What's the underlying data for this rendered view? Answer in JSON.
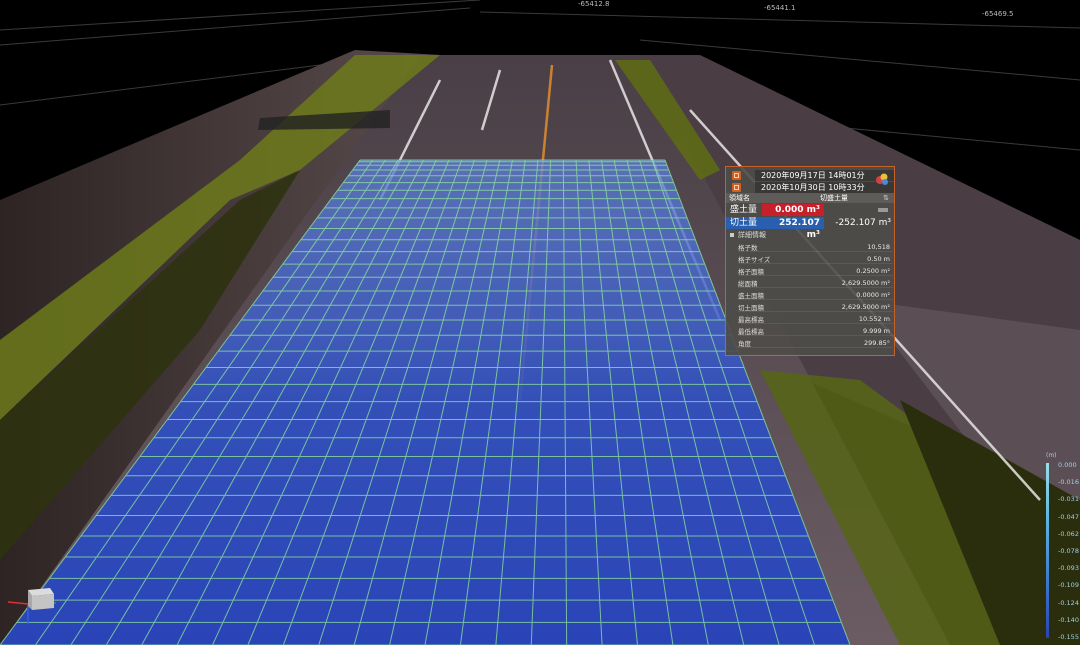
{
  "top_coords": [
    "-65412.8",
    "-65441.1",
    "-65469.5"
  ],
  "panel": {
    "date_before": "2020年09月17日 14時01分",
    "date_after": "2020年10月30日 10時33分",
    "header_name": "領域名",
    "header_cutfill": "切盛土量",
    "fill_label": "盛土量",
    "fill_value": "0.000 m³",
    "cut_label": "切土量",
    "cut_value": "252.107 m³",
    "net_value": "-252.107 m³",
    "detail_title": "詳細情報",
    "details": [
      {
        "label": "格子数",
        "value": "10,518"
      },
      {
        "label": "格子サイズ",
        "value": "0.50 m"
      },
      {
        "label": "格子面積",
        "value": "0.2500 m²"
      },
      {
        "label": "総面積",
        "value": "2,629.5000 m²"
      },
      {
        "label": "盛土面積",
        "value": "0.0000 m²"
      },
      {
        "label": "切土面積",
        "value": "2,629.5000 m²"
      },
      {
        "label": "最高標高",
        "value": "10.552 m"
      },
      {
        "label": "最低標高",
        "value": "9.999 m"
      },
      {
        "label": "角度",
        "value": "299.85°"
      }
    ],
    "colors": {
      "fill": "#c8202a",
      "cut": "#2a5fb0",
      "border": "#c8602a"
    }
  },
  "legend": {
    "unit": "(m)",
    "ticks": [
      "0.000",
      "-0.016",
      "-0.031",
      "-0.047",
      "-0.062",
      "-0.078",
      "-0.093",
      "-0.109",
      "-0.124",
      "-0.140",
      "-0.155"
    ]
  }
}
